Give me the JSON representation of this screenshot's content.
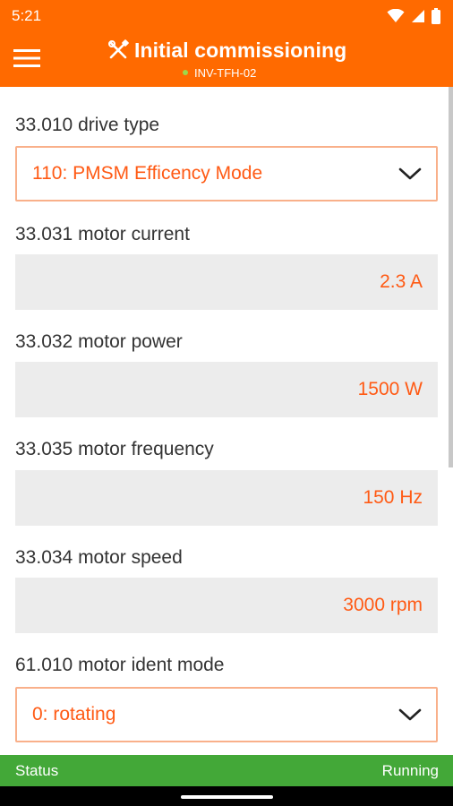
{
  "status_bar": {
    "time": "5:21"
  },
  "header": {
    "title": "Initial commissioning",
    "device": "INV-TFH-02"
  },
  "fields": {
    "drive_type": {
      "label": "33.010 drive type",
      "value": "110: PMSM Efficency Mode"
    },
    "motor_current": {
      "label": "33.031 motor current",
      "value": "2.3 A"
    },
    "motor_power": {
      "label": "33.032 motor power",
      "value": "1500 W"
    },
    "motor_frequency": {
      "label": "33.035 motor frequency",
      "value": "150 Hz"
    },
    "motor_speed": {
      "label": "33.034 motor speed",
      "value": "3000 rpm"
    },
    "ident_mode": {
      "label": "61.010 motor ident mode",
      "value": "0: rotating"
    }
  },
  "status_line": {
    "label": "Status",
    "value": "Running"
  },
  "colors": {
    "accent": "#ff6a00",
    "value_text": "#ff5a14",
    "status_ok": "#43a838",
    "online_dot": "#9ed84a"
  },
  "icons": {
    "menu": "hamburger-menu-icon",
    "title": "tools-icon",
    "dropdown": "chevron-down-icon",
    "wifi": "wifi-icon",
    "signal": "cell-signal-icon",
    "battery": "battery-icon"
  }
}
